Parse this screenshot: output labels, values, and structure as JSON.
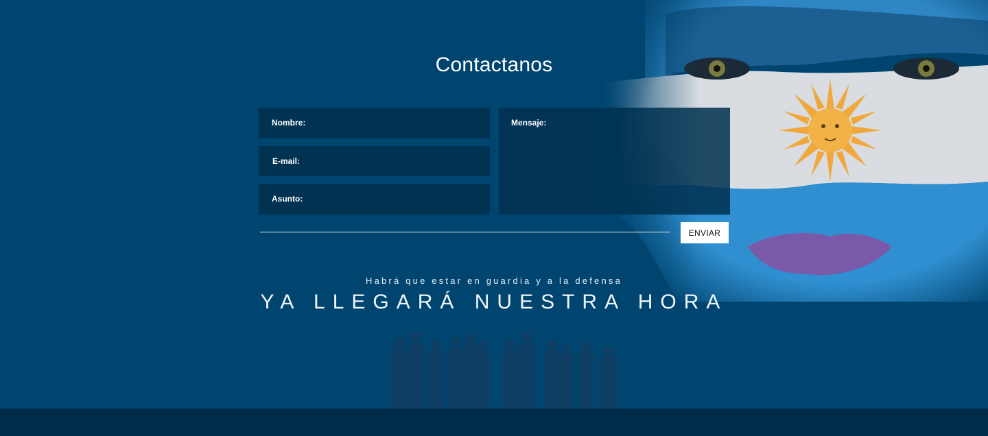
{
  "contact": {
    "title": "Contactanos",
    "fields": {
      "nombre": "Nombre:",
      "email": "E-mail:",
      "asunto": "Asunto:",
      "mensaje": "Mensaje:"
    },
    "send_label": "ENVIAR"
  },
  "slogan": {
    "subtitle": "Habrá que estar en guardia y a la defensa",
    "headline": "YA LLEGARÁ NUESTRA HORA"
  },
  "colors": {
    "background": "#004570",
    "field": "#003352",
    "footer": "#002c4a",
    "flag_blue": "#3a9ad6",
    "sun": "#f0a83c"
  }
}
